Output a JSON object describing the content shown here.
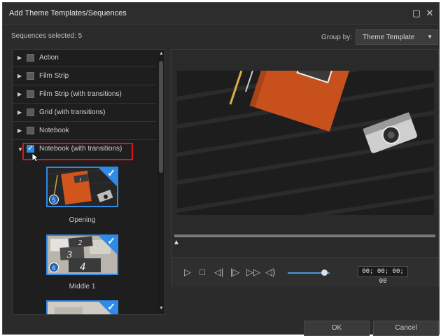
{
  "window": {
    "title": "Add Theme Templates/Sequences"
  },
  "status": {
    "selected_text": "Sequences selected: 5"
  },
  "group_by": {
    "label": "Group by:",
    "value": "Theme Template"
  },
  "tree": {
    "items": [
      {
        "label": "Action",
        "checked": false
      },
      {
        "label": "Film Strip",
        "checked": false
      },
      {
        "label": "Film Strip (with transitions)",
        "checked": false
      },
      {
        "label": "Grid (with transitions)",
        "checked": false
      },
      {
        "label": "Notebook",
        "checked": false
      },
      {
        "label": "Notebook (with transitions)",
        "checked": true
      }
    ],
    "thumbnails": [
      {
        "number": "5",
        "caption": "Opening"
      },
      {
        "number": "6",
        "caption": "Middle 1"
      }
    ]
  },
  "player": {
    "timecode": "00; 00; 00; 00",
    "volume": 0.9,
    "position": 0.0
  },
  "buttons": {
    "ok": "OK",
    "cancel": "Cancel"
  },
  "colors": {
    "accent": "#2f8be6",
    "highlight": "#e0141c",
    "background": "#2b2b2b"
  }
}
